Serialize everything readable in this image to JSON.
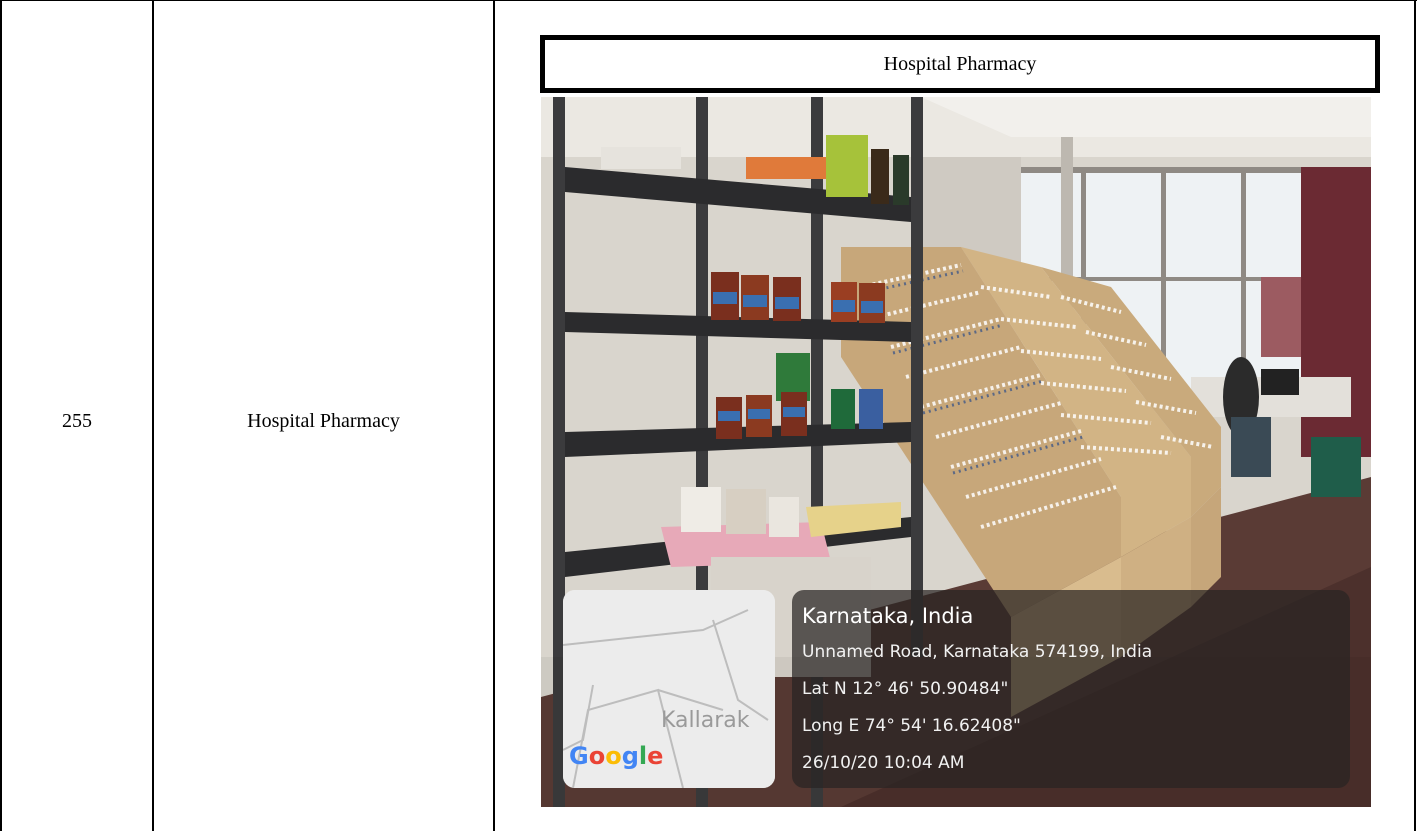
{
  "row": {
    "number": "255",
    "name": "Hospital Pharmacy",
    "photo_caption": "Hospital Pharmacy"
  },
  "geotag": {
    "map_label": "Kallarak",
    "map_brand": "Google",
    "location_title": "Karnataka, India",
    "address": "Unnamed Road, Karnataka 574199, India",
    "latitude": "Lat N 12° 46' 50.90484\"",
    "longitude": "Long E 74° 54' 16.62408\"",
    "timestamp": "26/10/20 10:04 AM"
  },
  "google_colors": [
    "#4285F4",
    "#EA4335",
    "#FBBC05",
    "#4285F4",
    "#34A853",
    "#EA4335"
  ]
}
